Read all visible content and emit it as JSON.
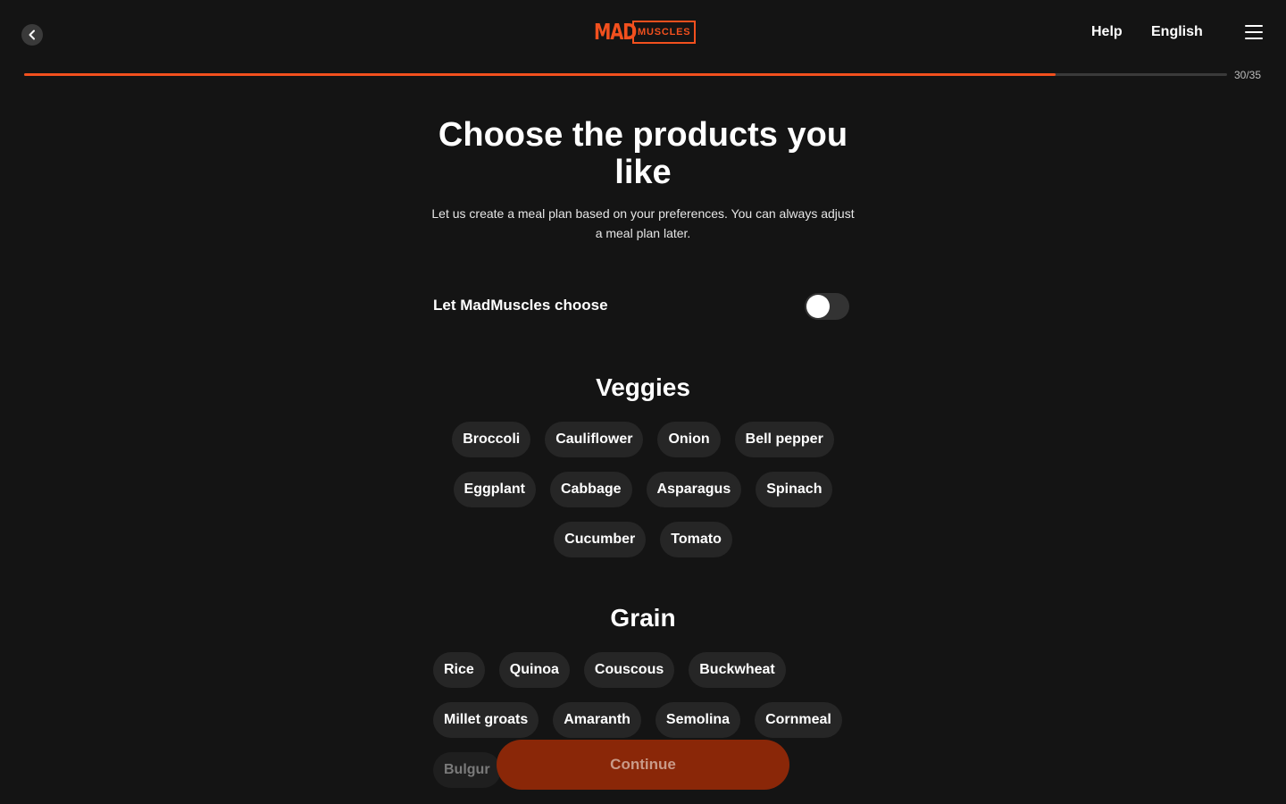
{
  "header": {
    "logo_mad": "MAD",
    "logo_muscles": "MUSCLES",
    "help_label": "Help",
    "language_label": "English"
  },
  "progress": {
    "text": "30/35",
    "current": 30,
    "total": 35
  },
  "page": {
    "title": "Choose the products you like",
    "subtitle": "Let us create a meal plan based on your preferences. You can always adjust a meal plan later."
  },
  "toggle": {
    "label": "Let MadMuscles choose",
    "on": false
  },
  "veggies": {
    "title": "Veggies",
    "items": [
      "Broccoli",
      "Cauliflower",
      "Onion",
      "Bell pepper",
      "Eggplant",
      "Cabbage",
      "Asparagus",
      "Spinach",
      "Cucumber",
      "Tomato"
    ]
  },
  "grain": {
    "title": "Grain",
    "items": [
      "Rice",
      "Quinoa",
      "Couscous",
      "Buckwheat",
      "Millet groats",
      "Amaranth",
      "Semolina",
      "Cornmeal",
      "Bulgur"
    ]
  },
  "footer": {
    "continue_label": "Continue"
  },
  "colors": {
    "accent": "#f2501e",
    "background": "#141414",
    "chip": "#262626",
    "continue_disabled": "#8a2708"
  }
}
